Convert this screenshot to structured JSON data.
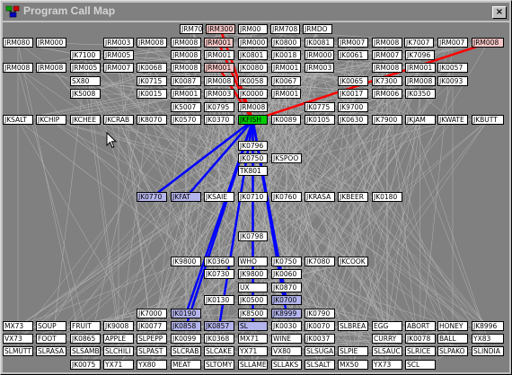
{
  "window": {
    "title": "Program Call Map",
    "close_label": "×"
  },
  "colors": {
    "callers_edge": "#ff0000",
    "callees_edge": "#0000ff",
    "selected_node": "#00cc00",
    "background_edge": "#b4b4b4"
  },
  "selected_node": "JKFISH",
  "nodes": [
    {
      "label": "JRM700",
      "state": "normal"
    },
    {
      "label": "JRM300",
      "state": "red"
    },
    {
      "label": "JRM00",
      "state": "normal"
    },
    {
      "label": "JRM708",
      "state": "normal"
    },
    {
      "label": "JRMDO",
      "state": "normal"
    },
    {
      "label": "JRM080",
      "state": "normal"
    },
    {
      "label": "JRM000",
      "state": "normal"
    },
    {
      "label": "JRM003",
      "state": "normal"
    },
    {
      "label": "JRM008",
      "state": "normal"
    },
    {
      "label": "JRM008",
      "state": "normal"
    },
    {
      "label": "JRM001",
      "state": "red"
    },
    {
      "label": "JRM000",
      "state": "normal"
    },
    {
      "label": "JK0800",
      "state": "normal"
    },
    {
      "label": "JK0081",
      "state": "normal"
    },
    {
      "label": "JRM007",
      "state": "normal"
    },
    {
      "label": "JRM008",
      "state": "normal"
    },
    {
      "label": "JK7007",
      "state": "normal"
    },
    {
      "label": "JRM007",
      "state": "normal"
    },
    {
      "label": "JRM008",
      "state": "red"
    },
    {
      "label": "JK7100",
      "state": "normal"
    },
    {
      "label": "JRM005",
      "state": "normal"
    },
    {
      "label": "JRM008",
      "state": "normal"
    },
    {
      "label": "JRM001",
      "state": "normal"
    },
    {
      "label": "JK0801",
      "state": "normal"
    },
    {
      "label": "JK0018",
      "state": "normal"
    },
    {
      "label": "JRM000",
      "state": "normal"
    },
    {
      "label": "JK0061",
      "state": "normal"
    },
    {
      "label": "JRM007",
      "state": "normal"
    },
    {
      "label": "JK7096",
      "state": "normal"
    },
    {
      "label": "JRM008",
      "state": "normal"
    },
    {
      "label": "JRM008",
      "state": "normal"
    },
    {
      "label": "JRM005",
      "state": "normal"
    },
    {
      "label": "JRM007",
      "state": "normal"
    },
    {
      "label": "JK0068",
      "state": "normal"
    },
    {
      "label": "JRM008",
      "state": "normal"
    },
    {
      "label": "JRM001",
      "state": "red"
    },
    {
      "label": "JK0080",
      "state": "normal"
    },
    {
      "label": "JRM001",
      "state": "normal"
    },
    {
      "label": "JRM003",
      "state": "normal"
    },
    {
      "label": "JRM008",
      "state": "normal"
    },
    {
      "label": "JRM001",
      "state": "normal"
    },
    {
      "label": "JK0057",
      "state": "normal"
    },
    {
      "label": "SX80",
      "state": "normal"
    },
    {
      "label": "JK0715",
      "state": "normal"
    },
    {
      "label": "JK0087",
      "state": "normal"
    },
    {
      "label": "JRM008",
      "state": "normal"
    },
    {
      "label": "JK0058",
      "state": "normal"
    },
    {
      "label": "JK0067",
      "state": "normal"
    },
    {
      "label": "JK0065",
      "state": "normal"
    },
    {
      "label": "JK7300",
      "state": "normal"
    },
    {
      "label": "JRM008",
      "state": "normal"
    },
    {
      "label": "JK0093",
      "state": "normal"
    },
    {
      "label": "JK5008",
      "state": "normal"
    },
    {
      "label": "JK0015",
      "state": "normal"
    },
    {
      "label": "JRM001",
      "state": "normal"
    },
    {
      "label": "JRM003",
      "state": "normal"
    },
    {
      "label": "JK0000",
      "state": "normal"
    },
    {
      "label": "JRM001",
      "state": "normal"
    },
    {
      "label": "JK0017",
      "state": "normal"
    },
    {
      "label": "JRM006",
      "state": "normal"
    },
    {
      "label": "JK0350",
      "state": "normal"
    },
    {
      "label": "JK5007",
      "state": "normal"
    },
    {
      "label": "JK0795",
      "state": "normal"
    },
    {
      "label": "JRM008",
      "state": "normal"
    },
    {
      "label": "JK0775",
      "state": "normal"
    },
    {
      "label": "JK9700",
      "state": "normal"
    },
    {
      "label": "JKSALT",
      "state": "normal"
    },
    {
      "label": "JKCHIP",
      "state": "normal"
    },
    {
      "label": "JKCHEE",
      "state": "normal"
    },
    {
      "label": "JKCRAB",
      "state": "normal"
    },
    {
      "label": "JK8070",
      "state": "normal"
    },
    {
      "label": "JK0570",
      "state": "normal"
    },
    {
      "label": "JK0370",
      "state": "normal"
    },
    {
      "label": "JKFISH",
      "state": "green"
    },
    {
      "label": "JK0089",
      "state": "normal"
    },
    {
      "label": "JK0105",
      "state": "normal"
    },
    {
      "label": "JK0630",
      "state": "normal"
    },
    {
      "label": "JK7900",
      "state": "normal"
    },
    {
      "label": "JKJAM",
      "state": "normal"
    },
    {
      "label": "JKWATE",
      "state": "normal"
    },
    {
      "label": "JKBUTT",
      "state": "normal"
    },
    {
      "label": "JK0796",
      "state": "normal"
    },
    {
      "label": "JK0750",
      "state": "normal"
    },
    {
      "label": "JKSPOO",
      "state": "normal"
    },
    {
      "label": "TK801",
      "state": "normal"
    },
    {
      "label": "JK0770",
      "state": "blue"
    },
    {
      "label": "JKFAT",
      "state": "blue"
    },
    {
      "label": "JKSAIE",
      "state": "normal"
    },
    {
      "label": "JK0710",
      "state": "normal"
    },
    {
      "label": "JK0760",
      "state": "normal"
    },
    {
      "label": "JKRASA",
      "state": "normal"
    },
    {
      "label": "JKBEER",
      "state": "normal"
    },
    {
      "label": "JK0180",
      "state": "normal"
    },
    {
      "label": "JK0798",
      "state": "normal"
    },
    {
      "label": "JK9800",
      "state": "normal"
    },
    {
      "label": "JK0360",
      "state": "normal"
    },
    {
      "label": "WHO",
      "state": "normal"
    },
    {
      "label": "JK0750",
      "state": "normal"
    },
    {
      "label": "JK7080",
      "state": "normal"
    },
    {
      "label": "JKCOOK",
      "state": "normal"
    },
    {
      "label": "JK0730",
      "state": "normal"
    },
    {
      "label": "JK9800",
      "state": "normal"
    },
    {
      "label": "JK0060",
      "state": "normal"
    },
    {
      "label": "UX",
      "state": "normal"
    },
    {
      "label": "JK0870",
      "state": "normal"
    },
    {
      "label": "JK0130",
      "state": "normal"
    },
    {
      "label": "JK0500",
      "state": "normal"
    },
    {
      "label": "JK0700",
      "state": "blue"
    },
    {
      "label": "JK7000",
      "state": "normal"
    },
    {
      "label": "JK0190",
      "state": "blue"
    },
    {
      "label": "JK8500",
      "state": "normal"
    },
    {
      "label": "JK8999",
      "state": "blue"
    },
    {
      "label": "JK0790",
      "state": "normal"
    },
    {
      "label": "MX73",
      "state": "normal"
    },
    {
      "label": "SOUP",
      "state": "normal"
    },
    {
      "label": "FRUIT",
      "state": "normal"
    },
    {
      "label": "JK9008",
      "state": "normal"
    },
    {
      "label": "JK0077",
      "state": "normal"
    },
    {
      "label": "JK0858",
      "state": "blue"
    },
    {
      "label": "JK0857",
      "state": "blue"
    },
    {
      "label": "SL",
      "state": "blue"
    },
    {
      "label": "JK0030",
      "state": "normal"
    },
    {
      "label": "JK0070",
      "state": "normal"
    },
    {
      "label": "SLBREA",
      "state": "normal"
    },
    {
      "label": "EGG",
      "state": "normal"
    },
    {
      "label": "ABORT",
      "state": "normal"
    },
    {
      "label": "HONEY",
      "state": "normal"
    },
    {
      "label": "JK8996",
      "state": "normal"
    },
    {
      "label": "VX73",
      "state": "normal"
    },
    {
      "label": "FOOT",
      "state": "normal"
    },
    {
      "label": "JK0865",
      "state": "normal"
    },
    {
      "label": "APPLE",
      "state": "normal"
    },
    {
      "label": "SLPEPP",
      "state": "normal"
    },
    {
      "label": "JK0099",
      "state": "normal"
    },
    {
      "label": "JK0368",
      "state": "normal"
    },
    {
      "label": "MX71",
      "state": "normal"
    },
    {
      "label": "WINE",
      "state": "normal"
    },
    {
      "label": "JK0037",
      "state": "normal"
    },
    {
      "label": "CURRY",
      "state": "normal"
    },
    {
      "label": "JK0078",
      "state": "normal"
    },
    {
      "label": "BALL",
      "state": "normal"
    },
    {
      "label": "YX83",
      "state": "normal"
    },
    {
      "label": "SLMUTT",
      "state": "normal"
    },
    {
      "label": "SLRASA",
      "state": "normal"
    },
    {
      "label": "SLSAMB",
      "state": "normal"
    },
    {
      "label": "SLCHILI",
      "state": "normal"
    },
    {
      "label": "SLPAST",
      "state": "normal"
    },
    {
      "label": "SLCRAB",
      "state": "normal"
    },
    {
      "label": "SLCAKE",
      "state": "normal"
    },
    {
      "label": "YX71",
      "state": "normal"
    },
    {
      "label": "VX80",
      "state": "normal"
    },
    {
      "label": "SLSUGA",
      "state": "normal"
    },
    {
      "label": "SLPIE",
      "state": "normal"
    },
    {
      "label": "SLSAUC",
      "state": "normal"
    },
    {
      "label": "SLRICE",
      "state": "normal"
    },
    {
      "label": "SLPAKO",
      "state": "normal"
    },
    {
      "label": "SLINDIA",
      "state": "normal"
    },
    {
      "label": "JK0075",
      "state": "normal"
    },
    {
      "label": "YX71",
      "state": "normal"
    },
    {
      "label": "YX80",
      "state": "normal"
    },
    {
      "label": "MEAT",
      "state": "normal"
    },
    {
      "label": "SLTOMY",
      "state": "normal"
    },
    {
      "label": "SLLAME",
      "state": "normal"
    },
    {
      "label": "SLLAKS",
      "state": "normal"
    },
    {
      "label": "SLSALT",
      "state": "normal"
    },
    {
      "label": "MX50",
      "state": "normal"
    },
    {
      "label": "YX73",
      "state": "normal"
    },
    {
      "label": "SCL",
      "state": "normal"
    }
  ]
}
